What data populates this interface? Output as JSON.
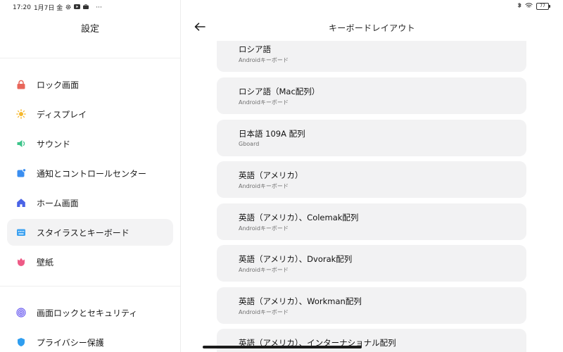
{
  "status_bar": {
    "time": "17:20",
    "date": "1月7日 金",
    "more": "···",
    "battery": "77",
    "left_icons": [
      "gear-icon",
      "youtube-icon",
      "briefcase-icon"
    ],
    "right_icons": [
      "bluetooth-icon",
      "wifi-icon",
      "battery-icon"
    ]
  },
  "sidebar": {
    "title": "設定",
    "items": [
      {
        "label": "ロック画面",
        "icon": "lock-icon",
        "color": "#e8665a"
      },
      {
        "label": "ディスプレイ",
        "icon": "sun-icon",
        "color": "#f5b82e"
      },
      {
        "label": "サウンド",
        "icon": "speaker-icon",
        "color": "#3cc48a"
      },
      {
        "label": "通知とコントロールセンター",
        "icon": "notification-icon",
        "color": "#3a8ef0"
      },
      {
        "label": "ホーム画面",
        "icon": "home-icon",
        "color": "#4a63e6"
      },
      {
        "label": "スタイラスとキーボード",
        "icon": "keyboard-icon",
        "color": "#3aa0f0",
        "selected": true
      },
      {
        "label": "壁紙",
        "icon": "tulip-icon",
        "color": "#ee5a86"
      },
      {
        "label": "画面ロックとセキュリティ",
        "icon": "fingerprint-icon",
        "color": "#6b5cf0"
      },
      {
        "label": "プライバシー保護",
        "icon": "shield-icon",
        "color": "#2f9ef0"
      }
    ]
  },
  "main": {
    "title": "キーボードレイアウト",
    "back_icon": "arrow-left-icon",
    "layouts": [
      {
        "title": "ロシア語",
        "subtitle": "Androidキーボード"
      },
      {
        "title": "ロシア語（Mac配列）",
        "subtitle": "Androidキーボード"
      },
      {
        "title": "日本語 109A 配列",
        "subtitle": "Gboard"
      },
      {
        "title": "英語（アメリカ）",
        "subtitle": "Androidキーボード"
      },
      {
        "title": "英語（アメリカ）、Colemak配列",
        "subtitle": "Androidキーボード"
      },
      {
        "title": "英語（アメリカ）、Dvorak配列",
        "subtitle": "Androidキーボード"
      },
      {
        "title": "英語（アメリカ）、Workman配列",
        "subtitle": "Androidキーボード"
      },
      {
        "title": "英語（アメリカ）、インターナショナル配列",
        "subtitle": ""
      }
    ]
  },
  "colors": {
    "card_bg": "#f2f2f3",
    "selected_bg": "#f3f3f4",
    "subtitle": "#6f6f6f"
  }
}
